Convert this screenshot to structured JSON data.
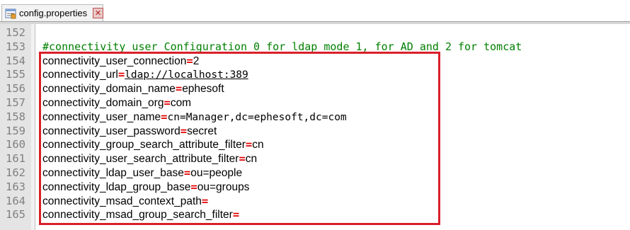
{
  "tab": {
    "label": "config.properties",
    "icon": "properties-file-icon",
    "close_icon": "close-icon",
    "close_glyph": "✕"
  },
  "colors": {
    "comment": "#008000",
    "equals": "#e00000",
    "line_number": "#808080",
    "gutter": "#e4e4e4",
    "highlight": "#d9202a"
  },
  "lines": [
    {
      "num": "152",
      "type": "blank"
    },
    {
      "num": "153",
      "type": "comment",
      "text": "#connectivity_user Configuration 0 for ldap mode 1, for AD and 2 for tomcat"
    },
    {
      "num": "154",
      "type": "prop",
      "key": "connectivity_user_connection",
      "eq": "=",
      "value": "2"
    },
    {
      "num": "155",
      "type": "prop",
      "key": "connectivity_url",
      "eq": "=",
      "value": "ldap://localhost:389",
      "style": "url"
    },
    {
      "num": "156",
      "type": "prop",
      "key": "connectivity_domain_name",
      "eq": "=",
      "value": "ephesoft"
    },
    {
      "num": "157",
      "type": "prop",
      "key": "connectivity_domain_org",
      "eq": "=",
      "value": "com"
    },
    {
      "num": "158",
      "type": "prop",
      "key": "connectivity_user_name",
      "eq": "=",
      "value": "cn=Manager,dc=ephesoft,dc=com",
      "style": "mono"
    },
    {
      "num": "159",
      "type": "prop",
      "key": "connectivity_user_password",
      "eq": "=",
      "value": "secret"
    },
    {
      "num": "160",
      "type": "prop",
      "key": "connectivity_group_search_attribute_filter",
      "eq": "=",
      "value": "cn"
    },
    {
      "num": "161",
      "type": "prop",
      "key": "connectivity_user_search_attribute_filter",
      "eq": "=",
      "value": "cn"
    },
    {
      "num": "162",
      "type": "prop",
      "key": "connectivity_ldap_user_base",
      "eq": "=",
      "value": "ou=people"
    },
    {
      "num": "163",
      "type": "prop",
      "key": "connectivity_ldap_group_base",
      "eq": "=",
      "value": "ou=groups"
    },
    {
      "num": "164",
      "type": "prop",
      "key": "connectivity_msad_context_path",
      "eq": "=",
      "value": ""
    },
    {
      "num": "165",
      "type": "prop",
      "key": "connectivity_msad_group_search_filter",
      "eq": "=",
      "value": ""
    }
  ]
}
